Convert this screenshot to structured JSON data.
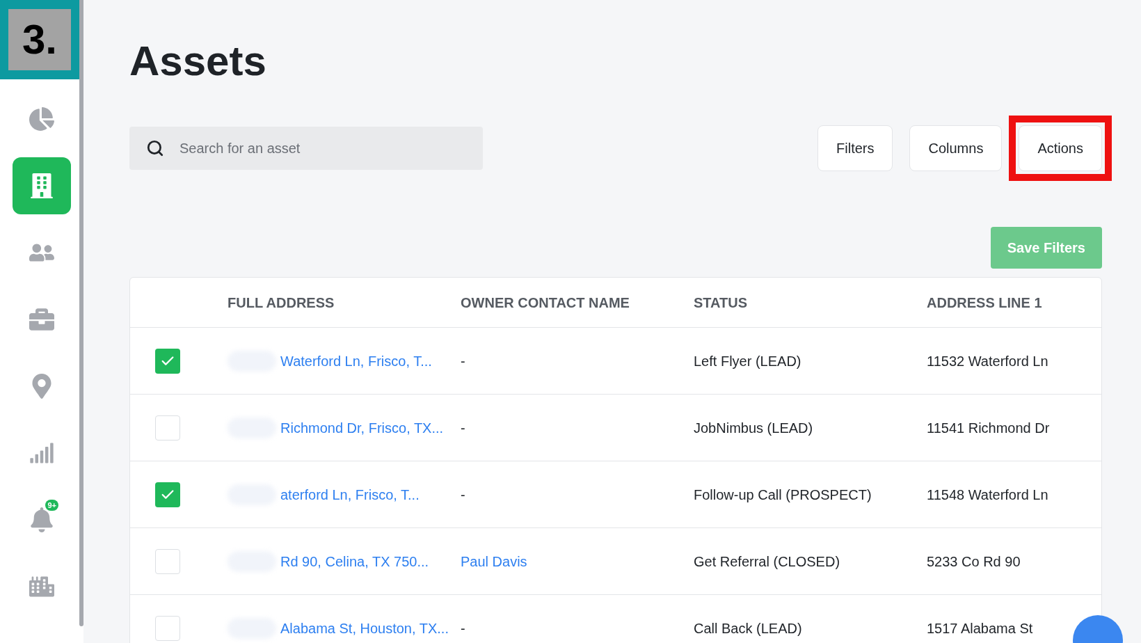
{
  "step_marker": "3.",
  "sidebar": {
    "items": [
      {
        "selected": false
      },
      {
        "selected": true
      },
      {
        "selected": false
      },
      {
        "selected": false
      },
      {
        "selected": false
      },
      {
        "selected": false
      },
      {
        "selected": false,
        "badge": "9+"
      },
      {
        "selected": false
      }
    ]
  },
  "page_title": "Assets",
  "search": {
    "placeholder": "Search for an asset"
  },
  "toolbar_buttons": [
    {
      "label": "Filters",
      "highlighted": false
    },
    {
      "label": "Columns",
      "highlighted": false
    },
    {
      "label": "Actions",
      "highlighted": true
    }
  ],
  "save_button": "Save Filters",
  "table": {
    "columns": [
      "FULL ADDRESS",
      "OWNER CONTACT NAME",
      "STATUS",
      "ADDRESS LINE 1"
    ],
    "rows": [
      {
        "checked": true,
        "full_address": "Waterford Ln, Frisco, T...",
        "owner": "-",
        "owner_link": false,
        "status": "Left Flyer (LEAD)",
        "address_line_1": "11532 Waterford Ln"
      },
      {
        "checked": false,
        "full_address": "Richmond Dr, Frisco, TX...",
        "owner": "-",
        "owner_link": false,
        "status": "JobNimbus (LEAD)",
        "address_line_1": "11541 Richmond Dr"
      },
      {
        "checked": true,
        "full_address": "aterford Ln, Frisco, T...",
        "owner": "-",
        "owner_link": false,
        "status": "Follow-up Call (PROSPECT)",
        "address_line_1": "11548 Waterford Ln"
      },
      {
        "checked": false,
        "full_address": "Rd 90, Celina, TX 750...",
        "owner": "Paul Davis",
        "owner_link": true,
        "status": "Get Referral (CLOSED)",
        "address_line_1": "5233 Co Rd 90"
      },
      {
        "checked": false,
        "full_address": "Alabama St, Houston, TX...",
        "owner": "-",
        "owner_link": false,
        "status": "Call Back (LEAD)",
        "address_line_1": "1517 Alabama St"
      }
    ]
  }
}
